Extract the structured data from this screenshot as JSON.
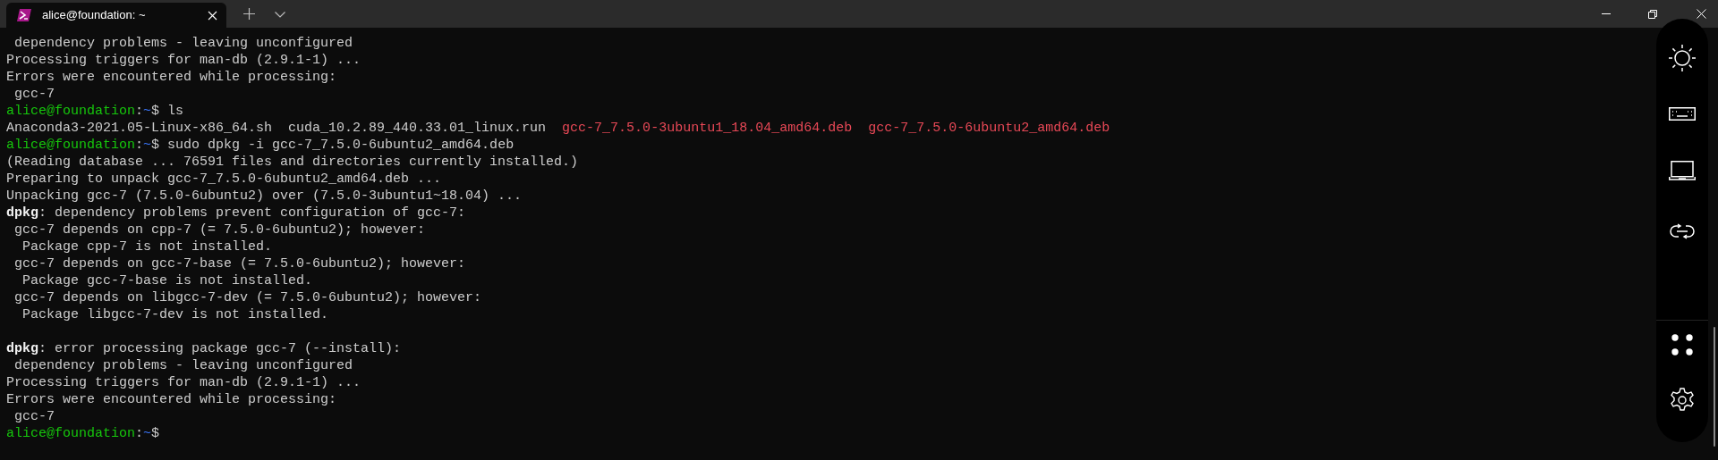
{
  "tabs": [
    {
      "title": "alice@foundation: ~",
      "selected": true
    }
  ],
  "terminal": {
    "lines": [
      {
        "kind": "text",
        "segments": [
          {
            "kind": "plain",
            "text": " dependency problems - leaving unconfigured"
          }
        ]
      },
      {
        "kind": "text",
        "segments": [
          {
            "kind": "plain",
            "text": "Processing triggers for man-db (2.9.1-1) ..."
          }
        ]
      },
      {
        "kind": "text",
        "segments": [
          {
            "kind": "plain",
            "text": "Errors were encountered while processing:"
          }
        ]
      },
      {
        "kind": "text",
        "segments": [
          {
            "kind": "plain",
            "text": " gcc-7"
          }
        ]
      },
      {
        "kind": "text",
        "segments": [
          {
            "kind": "user",
            "text": "alice@foundation"
          },
          {
            "kind": "plain",
            "text": ":"
          },
          {
            "kind": "path",
            "text": "~"
          },
          {
            "kind": "plain",
            "text": "$ ls"
          }
        ]
      },
      {
        "kind": "text",
        "segments": [
          {
            "kind": "plain",
            "text": "Anaconda3-2021.05-Linux-x86_64.sh  cuda_10.2.89_440.33.01_linux.run  "
          },
          {
            "kind": "deb",
            "text": "gcc-7_7.5.0-3ubuntu1_18.04_amd64.deb  gcc-7_7.5.0-6ubuntu2_amd64.deb"
          }
        ]
      },
      {
        "kind": "text",
        "segments": [
          {
            "kind": "user",
            "text": "alice@foundation"
          },
          {
            "kind": "plain",
            "text": ":"
          },
          {
            "kind": "path",
            "text": "~"
          },
          {
            "kind": "plain",
            "text": "$ sudo dpkg -i gcc-7_7.5.0-6ubuntu2_amd64.deb"
          }
        ]
      },
      {
        "kind": "text",
        "segments": [
          {
            "kind": "plain",
            "text": "(Reading database ... 76591 files and directories currently installed.)"
          }
        ]
      },
      {
        "kind": "text",
        "segments": [
          {
            "kind": "plain",
            "text": "Preparing to unpack gcc-7_7.5.0-6ubuntu2_amd64.deb ..."
          }
        ]
      },
      {
        "kind": "text",
        "segments": [
          {
            "kind": "plain",
            "text": "Unpacking gcc-7 (7.5.0-6ubuntu2) over (7.5.0-3ubuntu1~18.04) ..."
          }
        ]
      },
      {
        "kind": "text",
        "segments": [
          {
            "kind": "bold",
            "text": "dpkg"
          },
          {
            "kind": "plain",
            "text": ": dependency problems prevent configuration of gcc-7:"
          }
        ]
      },
      {
        "kind": "text",
        "segments": [
          {
            "kind": "plain",
            "text": " gcc-7 depends on cpp-7 (= 7.5.0-6ubuntu2); however:"
          }
        ]
      },
      {
        "kind": "text",
        "segments": [
          {
            "kind": "plain",
            "text": "  Package cpp-7 is not installed."
          }
        ]
      },
      {
        "kind": "text",
        "segments": [
          {
            "kind": "plain",
            "text": " gcc-7 depends on gcc-7-base (= 7.5.0-6ubuntu2); however:"
          }
        ]
      },
      {
        "kind": "text",
        "segments": [
          {
            "kind": "plain",
            "text": "  Package gcc-7-base is not installed."
          }
        ]
      },
      {
        "kind": "text",
        "segments": [
          {
            "kind": "plain",
            "text": " gcc-7 depends on libgcc-7-dev (= 7.5.0-6ubuntu2); however:"
          }
        ]
      },
      {
        "kind": "text",
        "segments": [
          {
            "kind": "plain",
            "text": "  Package libgcc-7-dev is not installed."
          }
        ]
      },
      {
        "kind": "blank"
      },
      {
        "kind": "text",
        "segments": [
          {
            "kind": "bold",
            "text": "dpkg"
          },
          {
            "kind": "plain",
            "text": ": error processing package gcc-7 (--install):"
          }
        ]
      },
      {
        "kind": "text",
        "segments": [
          {
            "kind": "plain",
            "text": " dependency problems - leaving unconfigured"
          }
        ]
      },
      {
        "kind": "text",
        "segments": [
          {
            "kind": "plain",
            "text": "Processing triggers for man-db (2.9.1-1) ..."
          }
        ]
      },
      {
        "kind": "text",
        "segments": [
          {
            "kind": "plain",
            "text": "Errors were encountered while processing:"
          }
        ]
      },
      {
        "kind": "text",
        "segments": [
          {
            "kind": "plain",
            "text": " gcc-7"
          }
        ]
      },
      {
        "kind": "text",
        "segments": [
          {
            "kind": "user",
            "text": "alice@foundation"
          },
          {
            "kind": "plain",
            "text": ":"
          },
          {
            "kind": "path",
            "text": "~"
          },
          {
            "kind": "plain",
            "text": "$"
          }
        ]
      }
    ]
  }
}
